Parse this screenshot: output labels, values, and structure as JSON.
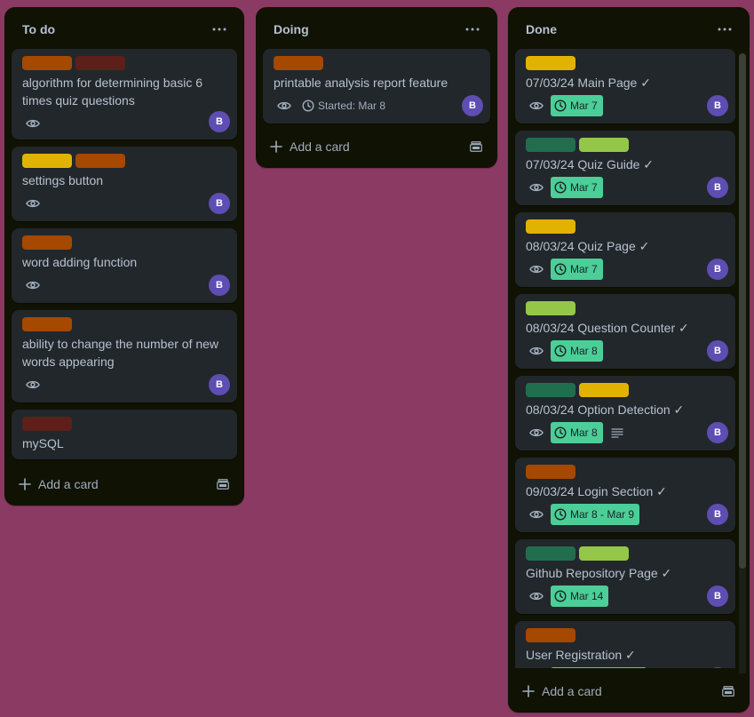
{
  "colors": {
    "board_bg": "#8b3a64",
    "list_bg": "#101204",
    "card_bg": "#22272b",
    "label_orange": "#a54800",
    "label_red": "#5d1f1a",
    "label_yellow": "#e2b203",
    "label_green": "#216e4e",
    "label_lime": "#94c748",
    "date_done": "#4bce97",
    "avatar": "#5e4db2"
  },
  "lists": {
    "todo": {
      "title": "To do",
      "add_label": "Add a card",
      "cards": [
        {
          "labels": [
            "orange",
            "red"
          ],
          "title": "algorithm for determining basic 6 times quiz questions",
          "avatar": "B"
        },
        {
          "labels": [
            "yellow",
            "orange"
          ],
          "title": "settings button",
          "avatar": "B"
        },
        {
          "labels": [
            "orange"
          ],
          "title": "word adding function",
          "avatar": "B"
        },
        {
          "labels": [
            "orange"
          ],
          "title": "ability to change the number of new words appearing",
          "avatar": "B"
        },
        {
          "labels": [
            "red"
          ],
          "title": "mySQL"
        }
      ]
    },
    "doing": {
      "title": "Doing",
      "add_label": "Add a card",
      "cards": [
        {
          "labels": [
            "orange"
          ],
          "title": "printable analysis report feature",
          "started": "Started: Mar 8",
          "avatar": "B"
        }
      ]
    },
    "done": {
      "title": "Done",
      "add_label": "Add a card",
      "cards": [
        {
          "labels": [
            "yellow"
          ],
          "title": "07/03/24 Main Page ✓",
          "date": "Mar 7",
          "avatar": "B"
        },
        {
          "labels": [
            "green",
            "lime"
          ],
          "title": "07/03/24 Quiz Guide ✓",
          "date": "Mar 7",
          "avatar": "B"
        },
        {
          "labels": [
            "yellow"
          ],
          "title": "08/03/24 Quiz Page ✓",
          "date": "Mar 7",
          "avatar": "B"
        },
        {
          "labels": [
            "lime"
          ],
          "title": "08/03/24 Question Counter ✓",
          "date": "Mar 8",
          "avatar": "B"
        },
        {
          "labels": [
            "green",
            "yellow"
          ],
          "title": "08/03/24 Option Detection ✓",
          "date": "Mar 8",
          "avatar": "B"
        },
        {
          "labels": [
            "orange"
          ],
          "title": "09/03/24 Login Section ✓",
          "date": "Mar 8 - Mar 9",
          "avatar": "B"
        },
        {
          "labels": [
            "green",
            "lime"
          ],
          "title": "Github Repository Page ✓",
          "date": "Mar 14",
          "avatar": "B"
        },
        {
          "labels": [
            "orange"
          ],
          "title": "User Registration ✓"
        }
      ]
    }
  }
}
